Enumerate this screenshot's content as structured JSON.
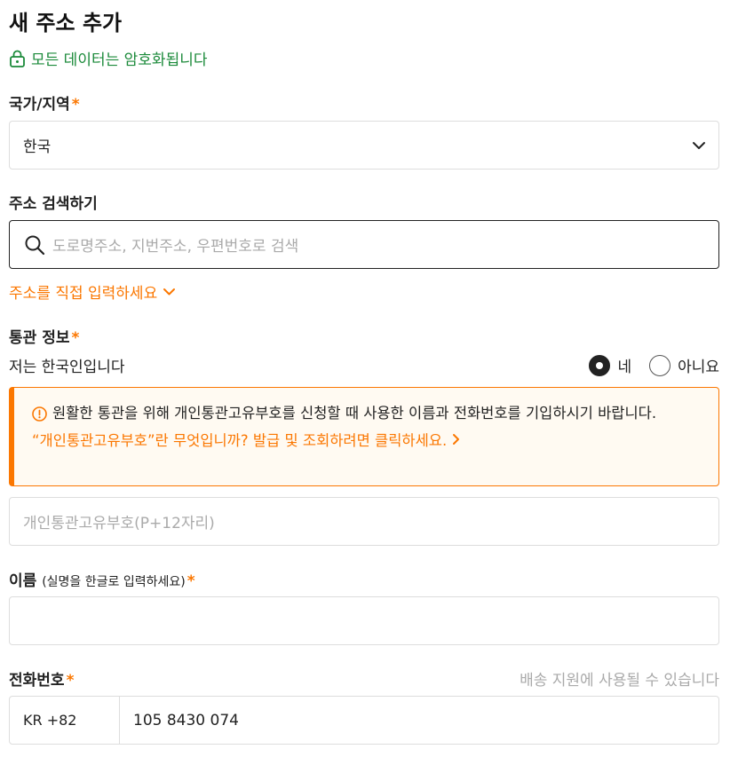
{
  "header": {
    "title": "새 주소 추가",
    "secure_text": "모든 데이터는 암호화됩니다"
  },
  "country": {
    "label": "국가/지역",
    "required_mark": "*",
    "value": "한국"
  },
  "address_search": {
    "label": "주소 검색하기",
    "placeholder": "도로명주소, 지번주소, 우편번호로 검색"
  },
  "manual_entry": {
    "label": "주소를 직접 입력하세요"
  },
  "customs": {
    "label": "통관 정보",
    "required_mark": "*",
    "question": "저는 한국인입니다",
    "options": [
      {
        "label": "네",
        "selected": true
      },
      {
        "label": "아니요",
        "selected": false
      }
    ],
    "notice_text": "원활한 통관을 위해 개인통관고유부호를 신청할 때 사용한 이름과 전화번호를 기입하시기 바랍니다.",
    "notice_link": "“개인통관고유부호”란 무엇입니까? 발급 및 조회하려면 클릭하세요.",
    "pccc_placeholder": "개인통관고유부호(P+12자리)"
  },
  "name": {
    "label": "이름",
    "note": "(실명을 한글로 입력하세요)",
    "required_mark": "*",
    "value": ""
  },
  "phone": {
    "label": "전화번호",
    "required_mark": "*",
    "hint": "배송 지원에 사용될 수 있습니다",
    "country_code": "KR +82",
    "number": "105 8430 074"
  },
  "colors": {
    "accent": "#fb7701",
    "secure_green": "#1b8a3a",
    "border": "#dddddd"
  }
}
